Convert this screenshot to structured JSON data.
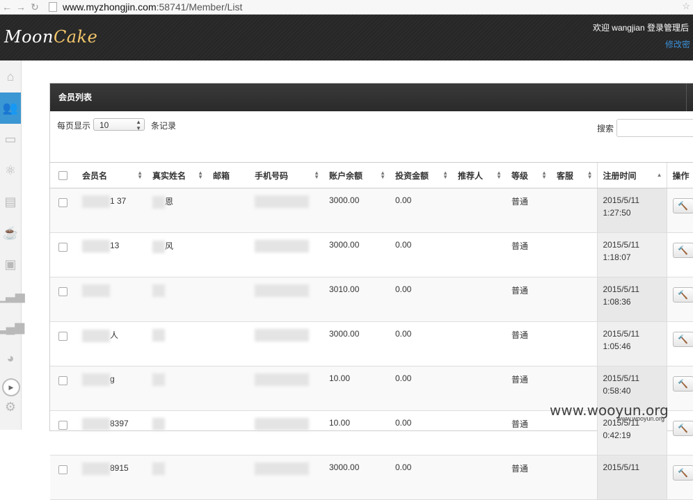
{
  "browser": {
    "url_host": "www.myzhongjin.com",
    "url_rest": ":58741/Member/List"
  },
  "header": {
    "logo_part1": "Moon",
    "logo_part2": "Cake",
    "welcome": "欢迎 wangjian 登录管理后",
    "modify_link": "修改密"
  },
  "sidebar": {
    "items": [
      {
        "icon": "home-icon"
      },
      {
        "icon": "users-icon",
        "active": true
      },
      {
        "icon": "inbox-icon"
      },
      {
        "icon": "atom-icon"
      },
      {
        "icon": "newspaper-icon"
      },
      {
        "icon": "coffee-icon"
      },
      {
        "icon": "briefcase-icon"
      },
      {
        "icon": "bar-chart-icon"
      },
      {
        "icon": "bar-chart-icon"
      },
      {
        "icon": "pie-chart-icon"
      }
    ]
  },
  "panel": {
    "title": "会员列表",
    "length_label": "每页显示",
    "length_value": "10",
    "length_suffix": "条记录",
    "search_label": "搜索"
  },
  "table": {
    "columns": [
      "会员名",
      "真实姓名",
      "邮箱",
      "手机号码",
      "账户余额",
      "投资金额",
      "推荐人",
      "等级",
      "客服",
      "注册时间",
      "操作"
    ],
    "rows": [
      {
        "username": "1 37",
        "realname": "恩",
        "balance": "3000.00",
        "invest": "0.00",
        "level": "普通",
        "date": "2015/5/11",
        "time": "1:27:50"
      },
      {
        "username": "13",
        "realname": "风",
        "balance": "3000.00",
        "invest": "0.00",
        "level": "普通",
        "date": "2015/5/11",
        "time": "1:18:07"
      },
      {
        "username": "",
        "realname": "",
        "balance": "3010.00",
        "invest": "0.00",
        "level": "普通",
        "date": "2015/5/11",
        "time": "1:08:36"
      },
      {
        "username": "人",
        "realname": "",
        "balance": "3000.00",
        "invest": "0.00",
        "level": "普通",
        "date": "2015/5/11",
        "time": "1:05:46"
      },
      {
        "username": "g",
        "realname": "",
        "balance": "10.00",
        "invest": "0.00",
        "level": "普通",
        "date": "2015/5/11",
        "time": "0:58:40"
      },
      {
        "username": "8397",
        "realname": "",
        "balance": "10.00",
        "invest": "0.00",
        "level": "普通",
        "date": "2015/5/11",
        "time": "0:42:19"
      },
      {
        "username": "8915",
        "realname": "",
        "balance": "3000.00",
        "invest": "0.00",
        "level": "普通",
        "date": "2015/5/11",
        "time": ""
      }
    ]
  },
  "watermark": {
    "main": "www.wooyun.org",
    "small": "www.wooyun.org"
  }
}
